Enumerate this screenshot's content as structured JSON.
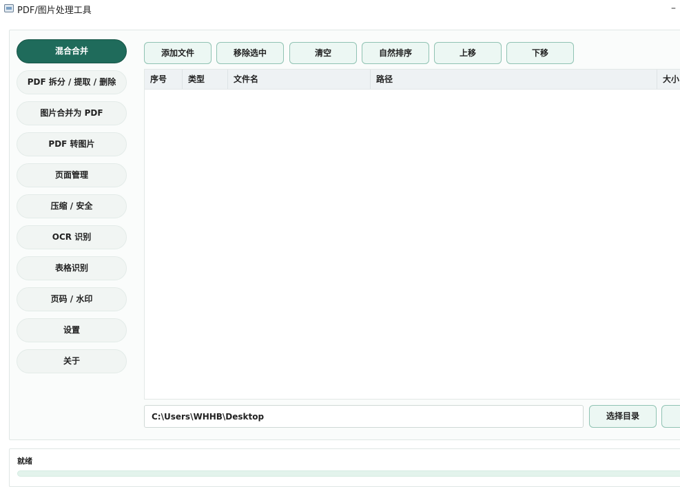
{
  "window": {
    "title": "PDF/图片处理工具",
    "minimize_glyph": "–"
  },
  "sidebar": {
    "items": [
      {
        "label": "混合合并",
        "active": true
      },
      {
        "label": "PDF 拆分 / 提取 / 删除"
      },
      {
        "label": "图片合并为 PDF"
      },
      {
        "label": "PDF 转图片"
      },
      {
        "label": "页面管理"
      },
      {
        "label": "压缩 / 安全"
      },
      {
        "label": "OCR 识别"
      },
      {
        "label": "表格识别"
      },
      {
        "label": "页码 / 水印"
      },
      {
        "label": "设置"
      },
      {
        "label": "关于"
      }
    ]
  },
  "toolbar": {
    "add_files": "添加文件",
    "remove_selected": "移除选中",
    "clear": "清空",
    "natural_sort": "自然排序",
    "move_up": "上移",
    "move_down": "下移"
  },
  "table": {
    "columns": [
      "序号",
      "类型",
      "文件名",
      "路径",
      "大小"
    ],
    "rows": []
  },
  "output": {
    "path_value": "C:\\Users\\WHHB\\Desktop",
    "select_dir": "选择目录"
  },
  "status": {
    "text": "就绪",
    "progress": 0
  },
  "colors": {
    "accent": "#1f6b5b",
    "button_bg": "#ecf7f3",
    "button_border": "#8fc2b2"
  }
}
